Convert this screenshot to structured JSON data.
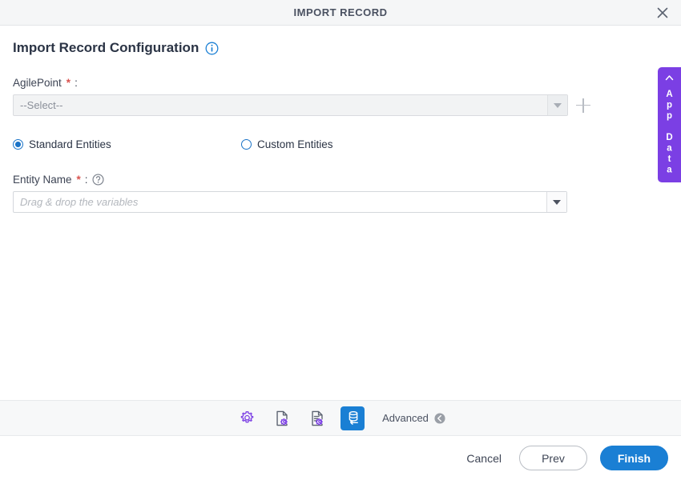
{
  "titlebar": {
    "title": "IMPORT RECORD",
    "close_icon": "close-icon"
  },
  "page": {
    "heading": "Import Record Configuration",
    "info_icon": "info-circle-icon"
  },
  "fields": {
    "agilepoint": {
      "label": "AgilePoint",
      "required_mark": "*",
      "colon": ":",
      "value": "--Select--",
      "disabled": true,
      "dropdown_icon": "chevron-down-icon",
      "add_icon": "plus-icon"
    },
    "entity_name": {
      "label": "Entity Name",
      "required_mark": "*",
      "colon": ":",
      "help_icon": "question-circle-icon",
      "value": "",
      "placeholder": "Drag & drop the variables",
      "dropdown_icon": "chevron-down-icon"
    }
  },
  "entity_type": {
    "options": [
      {
        "label": "Standard Entities",
        "selected": true
      },
      {
        "label": "Custom Entities",
        "selected": false
      }
    ]
  },
  "app_data_tab": {
    "label": "App Data",
    "chevron_icon": "chevron-left-icon"
  },
  "toolbar": {
    "buttons": [
      {
        "name": "general-settings",
        "icon": "gear-icon",
        "active": false
      },
      {
        "name": "document-settings",
        "icon": "document-gear-icon",
        "active": false
      },
      {
        "name": "form-settings",
        "icon": "document-lines-gear-icon",
        "active": false
      },
      {
        "name": "import-record",
        "icon": "database-import-icon",
        "active": true
      }
    ],
    "advanced": {
      "label": "Advanced",
      "icon": "circle-arrow-left-icon"
    }
  },
  "footer": {
    "cancel": "Cancel",
    "prev": "Prev",
    "finish": "Finish"
  },
  "colors": {
    "accent_blue": "#1a7fd4",
    "radio_blue": "#1a73c7",
    "purple": "#7b3fe4",
    "icon_purple": "#7b3fe4",
    "required_red": "#d9534f",
    "titlebar_bg": "#f5f6f7",
    "toolbar_bg": "#f7f8f9"
  }
}
